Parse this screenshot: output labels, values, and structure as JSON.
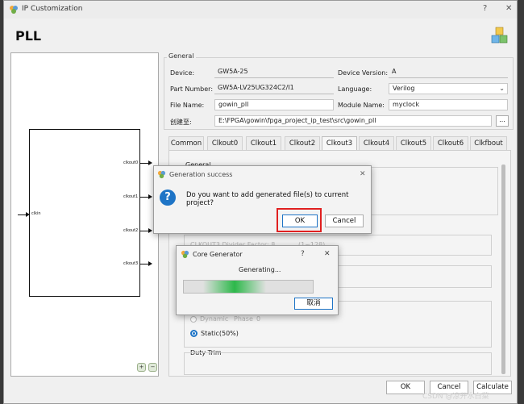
{
  "window": {
    "title": "IP Customization",
    "help": "?",
    "close": "✕"
  },
  "page_title": "PLL",
  "diagram": {
    "input_port": "clkin",
    "output_ports": [
      "clkout0",
      "clkout1",
      "clkout2",
      "clkout3"
    ],
    "zoom_in": "+",
    "zoom_out": "−"
  },
  "general": {
    "group_label": "General",
    "device_label": "Device:",
    "device_value": "GW5A-25",
    "device_version_label": "Device Version:",
    "device_version_value": "A",
    "part_number_label": "Part Number:",
    "part_number_value": "GW5A-LV25UG324C2/I1",
    "language_label": "Language:",
    "language_value": "Verilog",
    "file_name_label": "File Name:",
    "file_name_value": "gowin_pll",
    "module_name_label": "Module Name:",
    "module_name_value": "myclock",
    "create_in_label": "创建至:",
    "create_in_value": "E:\\FPGA\\gowin\\fpga_project_ip_test\\src\\gowin_pll",
    "browse": "..."
  },
  "tabs": [
    "Common",
    "Clkout0",
    "Clkout1",
    "Clkout2",
    "Clkout3",
    "Clkout4",
    "Clkout5",
    "Clkout6",
    "Clkfbout"
  ],
  "active_tab": "Clkout3",
  "tab_content": {
    "general_label": "General",
    "divider_text": "CLKOUT3 Divider Factor: 8",
    "divider_range": "(1~128)",
    "dynamic_label": "Dynamic",
    "phase_label": "Phase",
    "phase_value": "0",
    "static_label": "Static(50%)",
    "duty_trim_label": "Duty Trim"
  },
  "buttons": {
    "ok": "OK",
    "cancel": "Cancel",
    "calculate": "Calculate"
  },
  "gen_success_dialog": {
    "title": "Generation success",
    "question": "Do you want to add generated file(s) to current project?",
    "ok": "OK",
    "cancel": "Cancel",
    "close": "✕",
    "icon": "?"
  },
  "core_gen_dialog": {
    "title": "Core Generator",
    "help": "?",
    "close": "✕",
    "status": "Generating...",
    "cancel": "取消"
  },
  "watermark": "CSDN @凉开水白菜",
  "colors": {
    "accent": "#1e74c6",
    "highlight": "#e02020",
    "progress": "#2db84a"
  }
}
